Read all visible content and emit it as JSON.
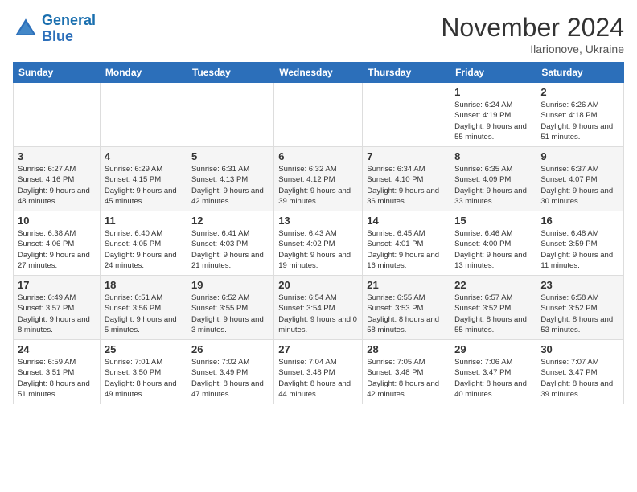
{
  "logo": {
    "line1": "General",
    "line2": "Blue"
  },
  "title": "November 2024",
  "location": "Ilarionove, Ukraine",
  "days_of_week": [
    "Sunday",
    "Monday",
    "Tuesday",
    "Wednesday",
    "Thursday",
    "Friday",
    "Saturday"
  ],
  "weeks": [
    [
      {
        "day": "",
        "info": ""
      },
      {
        "day": "",
        "info": ""
      },
      {
        "day": "",
        "info": ""
      },
      {
        "day": "",
        "info": ""
      },
      {
        "day": "",
        "info": ""
      },
      {
        "day": "1",
        "info": "Sunrise: 6:24 AM\nSunset: 4:19 PM\nDaylight: 9 hours and 55 minutes."
      },
      {
        "day": "2",
        "info": "Sunrise: 6:26 AM\nSunset: 4:18 PM\nDaylight: 9 hours and 51 minutes."
      }
    ],
    [
      {
        "day": "3",
        "info": "Sunrise: 6:27 AM\nSunset: 4:16 PM\nDaylight: 9 hours and 48 minutes."
      },
      {
        "day": "4",
        "info": "Sunrise: 6:29 AM\nSunset: 4:15 PM\nDaylight: 9 hours and 45 minutes."
      },
      {
        "day": "5",
        "info": "Sunrise: 6:31 AM\nSunset: 4:13 PM\nDaylight: 9 hours and 42 minutes."
      },
      {
        "day": "6",
        "info": "Sunrise: 6:32 AM\nSunset: 4:12 PM\nDaylight: 9 hours and 39 minutes."
      },
      {
        "day": "7",
        "info": "Sunrise: 6:34 AM\nSunset: 4:10 PM\nDaylight: 9 hours and 36 minutes."
      },
      {
        "day": "8",
        "info": "Sunrise: 6:35 AM\nSunset: 4:09 PM\nDaylight: 9 hours and 33 minutes."
      },
      {
        "day": "9",
        "info": "Sunrise: 6:37 AM\nSunset: 4:07 PM\nDaylight: 9 hours and 30 minutes."
      }
    ],
    [
      {
        "day": "10",
        "info": "Sunrise: 6:38 AM\nSunset: 4:06 PM\nDaylight: 9 hours and 27 minutes."
      },
      {
        "day": "11",
        "info": "Sunrise: 6:40 AM\nSunset: 4:05 PM\nDaylight: 9 hours and 24 minutes."
      },
      {
        "day": "12",
        "info": "Sunrise: 6:41 AM\nSunset: 4:03 PM\nDaylight: 9 hours and 21 minutes."
      },
      {
        "day": "13",
        "info": "Sunrise: 6:43 AM\nSunset: 4:02 PM\nDaylight: 9 hours and 19 minutes."
      },
      {
        "day": "14",
        "info": "Sunrise: 6:45 AM\nSunset: 4:01 PM\nDaylight: 9 hours and 16 minutes."
      },
      {
        "day": "15",
        "info": "Sunrise: 6:46 AM\nSunset: 4:00 PM\nDaylight: 9 hours and 13 minutes."
      },
      {
        "day": "16",
        "info": "Sunrise: 6:48 AM\nSunset: 3:59 PM\nDaylight: 9 hours and 11 minutes."
      }
    ],
    [
      {
        "day": "17",
        "info": "Sunrise: 6:49 AM\nSunset: 3:57 PM\nDaylight: 9 hours and 8 minutes."
      },
      {
        "day": "18",
        "info": "Sunrise: 6:51 AM\nSunset: 3:56 PM\nDaylight: 9 hours and 5 minutes."
      },
      {
        "day": "19",
        "info": "Sunrise: 6:52 AM\nSunset: 3:55 PM\nDaylight: 9 hours and 3 minutes."
      },
      {
        "day": "20",
        "info": "Sunrise: 6:54 AM\nSunset: 3:54 PM\nDaylight: 9 hours and 0 minutes."
      },
      {
        "day": "21",
        "info": "Sunrise: 6:55 AM\nSunset: 3:53 PM\nDaylight: 8 hours and 58 minutes."
      },
      {
        "day": "22",
        "info": "Sunrise: 6:57 AM\nSunset: 3:52 PM\nDaylight: 8 hours and 55 minutes."
      },
      {
        "day": "23",
        "info": "Sunrise: 6:58 AM\nSunset: 3:52 PM\nDaylight: 8 hours and 53 minutes."
      }
    ],
    [
      {
        "day": "24",
        "info": "Sunrise: 6:59 AM\nSunset: 3:51 PM\nDaylight: 8 hours and 51 minutes."
      },
      {
        "day": "25",
        "info": "Sunrise: 7:01 AM\nSunset: 3:50 PM\nDaylight: 8 hours and 49 minutes."
      },
      {
        "day": "26",
        "info": "Sunrise: 7:02 AM\nSunset: 3:49 PM\nDaylight: 8 hours and 47 minutes."
      },
      {
        "day": "27",
        "info": "Sunrise: 7:04 AM\nSunset: 3:48 PM\nDaylight: 8 hours and 44 minutes."
      },
      {
        "day": "28",
        "info": "Sunrise: 7:05 AM\nSunset: 3:48 PM\nDaylight: 8 hours and 42 minutes."
      },
      {
        "day": "29",
        "info": "Sunrise: 7:06 AM\nSunset: 3:47 PM\nDaylight: 8 hours and 40 minutes."
      },
      {
        "day": "30",
        "info": "Sunrise: 7:07 AM\nSunset: 3:47 PM\nDaylight: 8 hours and 39 minutes."
      }
    ]
  ]
}
